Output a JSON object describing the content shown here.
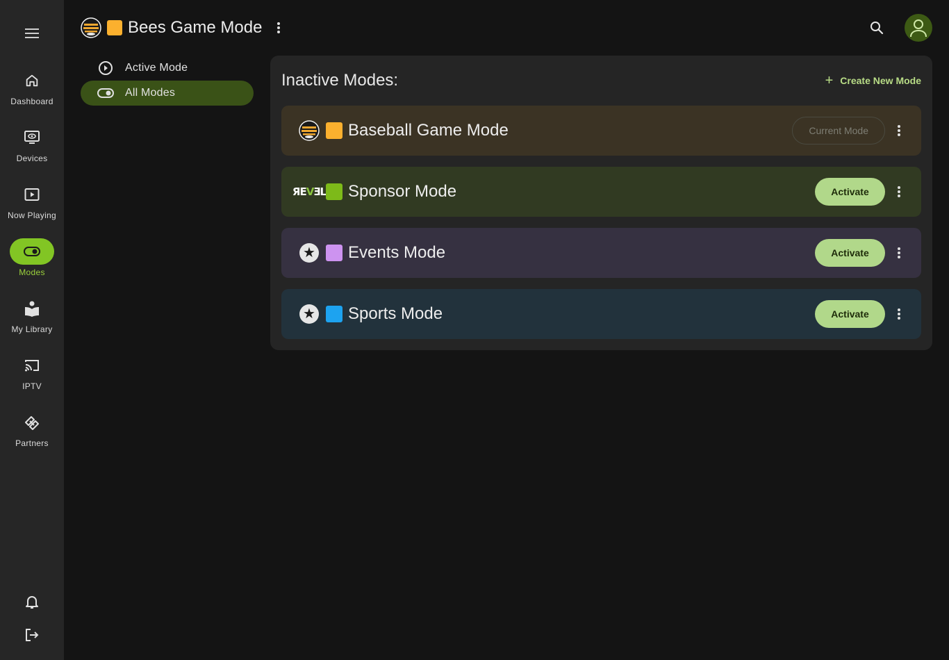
{
  "nav": {
    "items": [
      {
        "label": "Dashboard",
        "icon": "home-icon"
      },
      {
        "label": "Devices",
        "icon": "monitor-eye-icon"
      },
      {
        "label": "Now Playing",
        "icon": "play-box-icon"
      },
      {
        "label": "Modes",
        "icon": "toggle-icon",
        "active": true
      },
      {
        "label": "My Library",
        "icon": "library-icon"
      },
      {
        "label": "IPTV",
        "icon": "cast-icon"
      },
      {
        "label": "Partners",
        "icon": "handshake-icon"
      }
    ]
  },
  "header": {
    "title": "Bees Game Mode",
    "swatch_color": "#fbb02e"
  },
  "subnav": {
    "items": [
      {
        "label": "Active Mode",
        "icon": "play-circle-icon"
      },
      {
        "label": "All Modes",
        "icon": "toggle-icon",
        "active": true
      }
    ]
  },
  "panel": {
    "title": "Inactive Modes:",
    "create_label": "Create New Mode",
    "modes": [
      {
        "name": "Baseball Game Mode",
        "swatch": "#fbb02e",
        "row_bg": "#3b3324",
        "icon": "bees-logo-icon",
        "action": "Current Mode"
      },
      {
        "name": "Sponsor Mode",
        "swatch": "#7dba19",
        "row_bg": "#313a22",
        "icon": "revel-logo-icon",
        "logo_text": "REVEL",
        "action": "Activate"
      },
      {
        "name": "Events Mode",
        "swatch": "#cd93f0",
        "row_bg": "#363141",
        "icon": "star-icon",
        "action": "Activate"
      },
      {
        "name": "Sports Mode",
        "swatch": "#1da3f0",
        "row_bg": "#22323c",
        "icon": "star-icon",
        "action": "Activate"
      }
    ]
  },
  "accent_color": "#82c524"
}
